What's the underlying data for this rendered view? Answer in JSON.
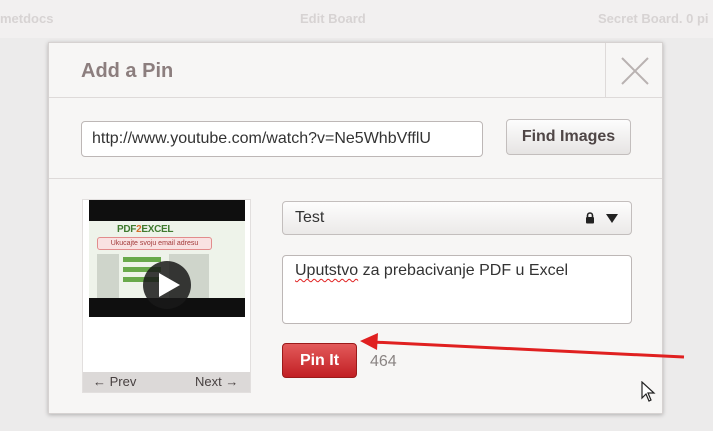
{
  "background_bar": {
    "left_text": "metdocs",
    "center_text": "Edit Board",
    "right_text": "Secret Board. 0 pi"
  },
  "dialog": {
    "title": "Add a Pin",
    "close_icon": "close-x-icon"
  },
  "url_row": {
    "url_value": "http://www.youtube.com/watch?v=Ne5WhbVfflU",
    "find_images_label": "Find Images"
  },
  "thumbnail": {
    "logo_text_a": "PDF",
    "logo_text_b": "2",
    "logo_text_c": "EXCEL",
    "email_prompt": "Ukucajte svoju email adresu",
    "play_icon": "play-icon",
    "prev_label": "← Prev",
    "next_label": "Next →"
  },
  "board_select": {
    "selected": "Test",
    "lock_icon": "lock-icon",
    "caret_icon": "caret-down-icon"
  },
  "description": {
    "word_1": "Uputstvo",
    "rest": " za prebacivanje PDF u Excel"
  },
  "actions": {
    "pin_it_label": "Pin It",
    "char_count": "464"
  },
  "colors": {
    "pin_red": "#c21f24",
    "annotation_red": "#e02020",
    "title_color": "#8c7e7e"
  }
}
